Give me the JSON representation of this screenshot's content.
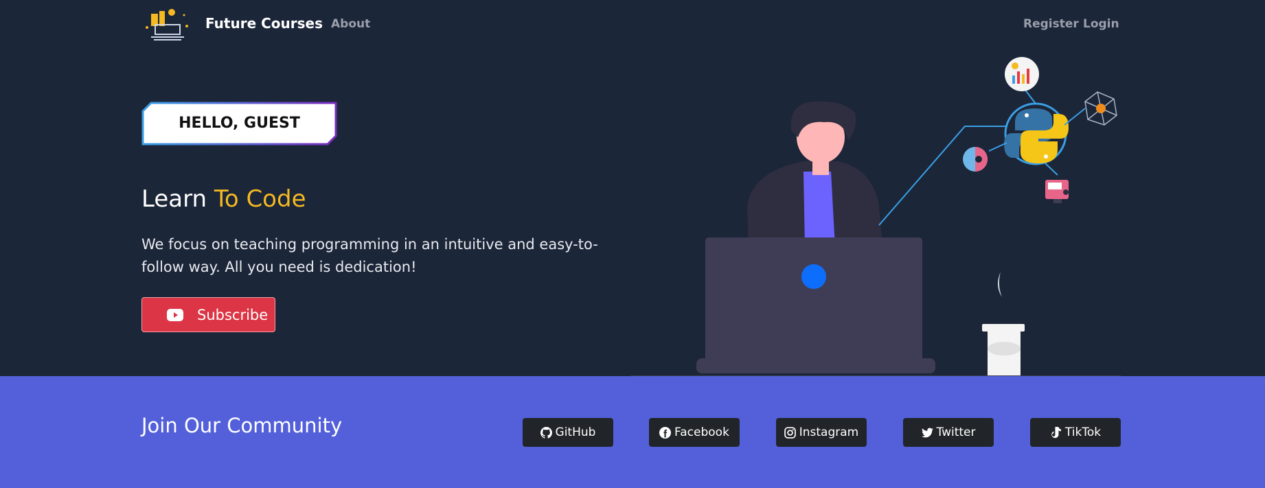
{
  "nav": {
    "brand": "Future Courses",
    "about": "About",
    "register": "Register",
    "login": "Login",
    "logo_icon": "laptop-lightbulb-logo"
  },
  "hero": {
    "greeting": "HELLO, GUEST",
    "headline_part1": "Learn ",
    "headline_accent": "To Code",
    "description": "We focus on teaching programming in an intuitive and easy-to-follow way. All you need is dedication!",
    "subscribe_label": "Subscribe",
    "subscribe_icon": "youtube-icon"
  },
  "community": {
    "title": "Join Our Community",
    "links": [
      {
        "label": "GitHub",
        "icon": "github-icon"
      },
      {
        "label": "Facebook",
        "icon": "facebook-icon"
      },
      {
        "label": "Instagram",
        "icon": "instagram-icon"
      },
      {
        "label": "Twitter",
        "icon": "twitter-icon"
      },
      {
        "label": "TikTok",
        "icon": "tiktok-icon"
      }
    ]
  },
  "colors": {
    "hero_bg": "#1c2639",
    "community_bg": "#5360d9",
    "accent": "#f5b921",
    "subscribe_bg": "#dc3545",
    "button_dark": "#212529"
  }
}
